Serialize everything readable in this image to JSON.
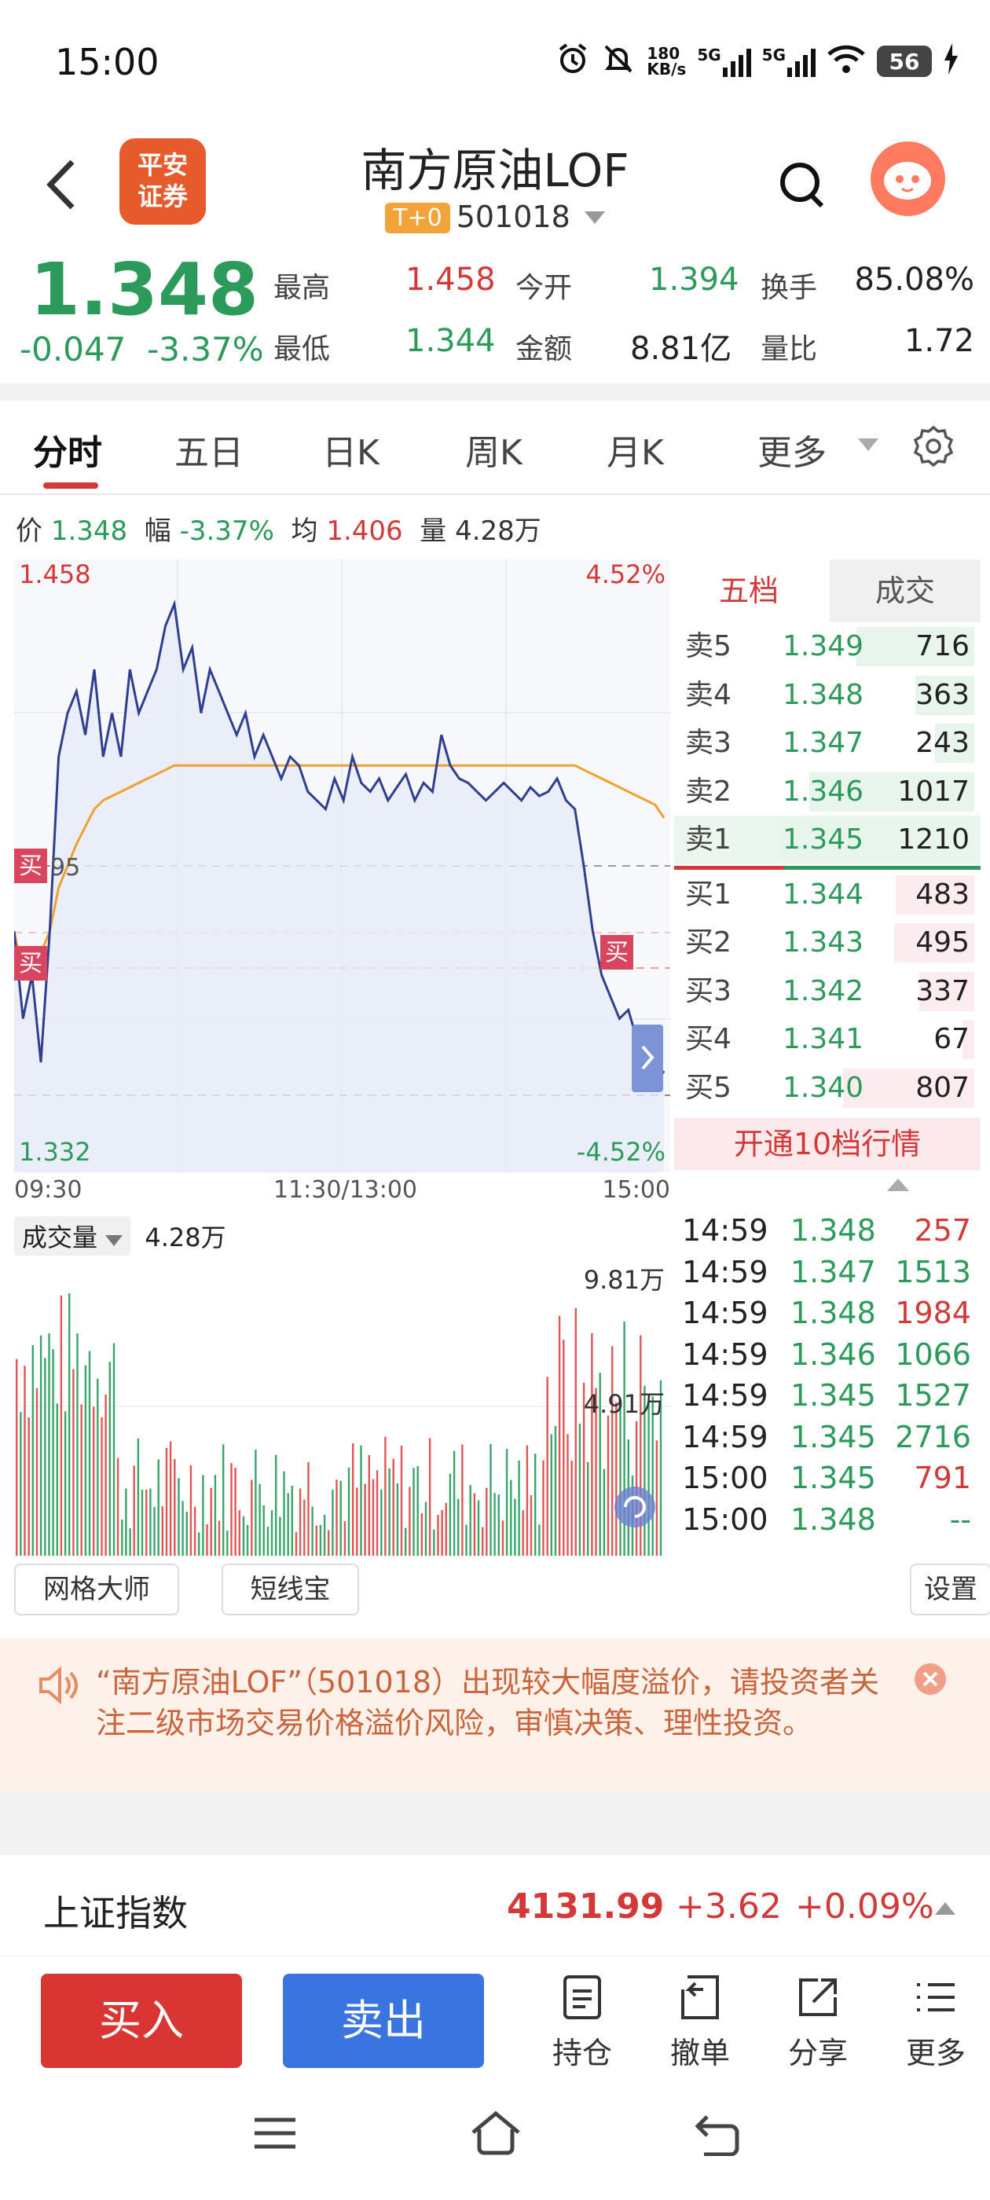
{
  "status": {
    "time": "15:00",
    "net_speed_top": "180",
    "net_speed_bottom": "KB/s",
    "net1": "5G",
    "net2": "5G",
    "battery": "56"
  },
  "header": {
    "logo_line1": "平安",
    "logo_line2": "证券",
    "name": "南方原油LOF",
    "badge": "T+0",
    "code": "501018"
  },
  "quote": {
    "price": "1.348",
    "change": "-0.047",
    "change_pct": "-3.37%",
    "high_label": "最高",
    "high": "1.458",
    "open_label": "今开",
    "open": "1.394",
    "turnover_label": "换手",
    "turnover": "85.08%",
    "low_label": "最低",
    "low": "1.344",
    "amount_label": "金额",
    "amount": "8.81亿",
    "ratio_label": "量比",
    "ratio": "1.72"
  },
  "tabs": [
    "分时",
    "五日",
    "日K",
    "周K",
    "月K",
    "更多"
  ],
  "info": {
    "price_label": "价",
    "price": "1.348",
    "pct_label": "幅",
    "pct": "-3.37%",
    "avg_label": "均",
    "avg": "1.406",
    "vol_label": "量",
    "vol": "4.28万"
  },
  "chart": {
    "max_price": "1.458",
    "min_price": "1.332",
    "max_pct": "4.52%",
    "min_pct": "-4.52%",
    "ref_label": "95",
    "buy_marker": "买",
    "time_start": "09:30",
    "time_mid": "11:30/13:00",
    "time_end": "15:00"
  },
  "chart_data": {
    "type": "line",
    "xlabel": "",
    "ylabel": "",
    "ylim": [
      1.332,
      1.458
    ],
    "series": [
      {
        "values": [
          1.38,
          1.36,
          1.37,
          1.35,
          1.38,
          1.42,
          1.43,
          1.435,
          1.425,
          1.44,
          1.42,
          1.43,
          1.42,
          1.44,
          1.43,
          1.435,
          1.44,
          1.45,
          1.455,
          1.44,
          1.445,
          1.43,
          1.44,
          1.435,
          1.43,
          1.425,
          1.43,
          1.42,
          1.425,
          1.42,
          1.415,
          1.42,
          1.418,
          1.412,
          1.41,
          1.408,
          1.415,
          1.41,
          1.42,
          1.414,
          1.412,
          1.415,
          1.41,
          1.413,
          1.416,
          1.41,
          1.414,
          1.412,
          1.425,
          1.418,
          1.415,
          1.414,
          1.412,
          1.41,
          1.412,
          1.414,
          1.412,
          1.41,
          1.413,
          1.411,
          1.412,
          1.415,
          1.41,
          1.408,
          1.395,
          1.38,
          1.37,
          1.365,
          1.36,
          1.362,
          1.355,
          1.35,
          1.345,
          1.348
        ]
      },
      {
        "values": [
          1.38,
          1.37,
          1.37,
          1.375,
          1.38,
          1.39,
          1.395,
          1.4,
          1.404,
          1.408,
          1.41,
          1.411,
          1.412,
          1.413,
          1.414,
          1.415,
          1.416,
          1.417,
          1.418,
          1.418,
          1.418,
          1.418,
          1.418,
          1.418,
          1.418,
          1.418,
          1.418,
          1.418,
          1.418,
          1.418,
          1.418,
          1.418,
          1.418,
          1.418,
          1.418,
          1.418,
          1.418,
          1.418,
          1.418,
          1.418,
          1.418,
          1.418,
          1.418,
          1.418,
          1.418,
          1.418,
          1.418,
          1.418,
          1.418,
          1.418,
          1.418,
          1.418,
          1.418,
          1.418,
          1.418,
          1.418,
          1.418,
          1.418,
          1.418,
          1.418,
          1.418,
          1.418,
          1.418,
          1.418,
          1.417,
          1.416,
          1.415,
          1.414,
          1.413,
          1.412,
          1.411,
          1.41,
          1.409,
          1.406
        ]
      }
    ]
  },
  "order_book": {
    "tab_five": "五档",
    "tab_trades": "成交",
    "asks": [
      {
        "label": "卖5",
        "price": "1.349",
        "vol": "716",
        "bar": 0.6
      },
      {
        "label": "卖4",
        "price": "1.348",
        "vol": "363",
        "bar": 0.3
      },
      {
        "label": "卖3",
        "price": "1.347",
        "vol": "243",
        "bar": 0.2
      },
      {
        "label": "卖2",
        "price": "1.346",
        "vol": "1017",
        "bar": 0.84
      },
      {
        "label": "卖1",
        "price": "1.345",
        "vol": "1210",
        "bar": 1.0
      }
    ],
    "bids": [
      {
        "label": "买1",
        "price": "1.344",
        "vol": "483",
        "bar": 0.4
      },
      {
        "label": "买2",
        "price": "1.343",
        "vol": "495",
        "bar": 0.41
      },
      {
        "label": "买3",
        "price": "1.342",
        "vol": "337",
        "bar": 0.28
      },
      {
        "label": "买4",
        "price": "1.341",
        "vol": "67",
        "bar": 0.06
      },
      {
        "label": "买5",
        "price": "1.340",
        "vol": "807",
        "bar": 0.67
      }
    ],
    "upgrade": "开通10档行情"
  },
  "volume": {
    "label": "成交量",
    "value": "4.28万",
    "max": "9.81万",
    "mid": "4.91万"
  },
  "trades": [
    {
      "time": "14:59",
      "price": "1.348",
      "vol": "257",
      "dir": "up"
    },
    {
      "time": "14:59",
      "price": "1.347",
      "vol": "1513",
      "dir": "down"
    },
    {
      "time": "14:59",
      "price": "1.348",
      "vol": "1984",
      "dir": "up"
    },
    {
      "time": "14:59",
      "price": "1.346",
      "vol": "1066",
      "dir": "down"
    },
    {
      "time": "14:59",
      "price": "1.345",
      "vol": "1527",
      "dir": "down"
    },
    {
      "time": "14:59",
      "price": "1.345",
      "vol": "2716",
      "dir": "down"
    },
    {
      "time": "15:00",
      "price": "1.345",
      "vol": "791",
      "dir": "up"
    },
    {
      "time": "15:00",
      "price": "1.348",
      "vol": "--",
      "dir": "down"
    }
  ],
  "tools": {
    "grid": "网格大师",
    "short": "短线宝",
    "settings": "设置"
  },
  "notice": "“南方原油LOF”（501018）出现较大幅度溢价，请投资者关注二级市场交易价格溢价风险，审慎决策、理性投资。",
  "index": {
    "name": "上证指数",
    "value": "4131.99",
    "change": "+3.62",
    "pct": "+0.09%"
  },
  "actions": {
    "buy": "买入",
    "sell": "卖出",
    "position": "持仓",
    "cancel": "撤单",
    "share": "分享",
    "more": "更多"
  },
  "colors": {
    "up": "#d23a3a",
    "down": "#2b9a5a",
    "price_line": "#2f3f8f",
    "avg_line": "#f0a030"
  }
}
